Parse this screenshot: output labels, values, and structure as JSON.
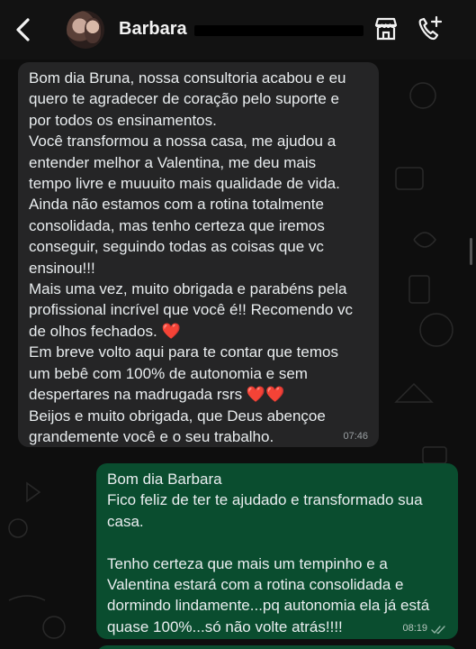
{
  "header": {
    "contact_name": "Barbara",
    "icons": {
      "back": "chevron-left-icon",
      "store": "storefront-icon",
      "call": "add-call-icon"
    }
  },
  "messages": {
    "incoming": {
      "lines": [
        "Bom dia Bruna, nossa consultoria acabou e eu",
        "quero te agradecer de coração pelo suporte e",
        "por todos os ensinamentos.",
        "Você transformou a nossa casa, me ajudou a",
        "entender melhor a Valentina, me deu mais",
        "tempo livre e muuuito mais qualidade de vida.",
        "Ainda não estamos com a rotina totalmente",
        "consolidada, mas tenho certeza que iremos",
        "conseguir, seguindo todas as coisas que vc",
        "ensinou!!!",
        "Mais uma vez, muito obrigada e parabéns pela",
        "profissional incrível que você é!! Recomendo vc",
        "de olhos fechados.",
        "Em breve volto aqui para te contar que temos",
        "um bebê com 100% de autonomia e sem",
        "despertares na madrugada rsrs",
        "Beijos e muito obrigada, que Deus abençoe",
        "grandemente você e o seu trabalho."
      ],
      "heart_emoji": "❤️",
      "time": "07:46"
    },
    "outgoing": {
      "lines": [
        "Bom dia Barbara",
        "Fico feliz de ter te ajudado e transformado sua",
        "casa.",
        "",
        "Tenho certeza que mais um tempinho e a",
        "Valentina estará com a rotina consolidada e",
        "dormindo lindamente...pq autonomia ela já está",
        "quase 100%...só não volte atrás!!!!"
      ],
      "time": "08:19",
      "status": "read"
    }
  },
  "colors": {
    "incoming_bubble": "#252526",
    "outgoing_bubble": "#0a4d2f",
    "background": "#0e0e0e",
    "heart": "#e0263a"
  }
}
